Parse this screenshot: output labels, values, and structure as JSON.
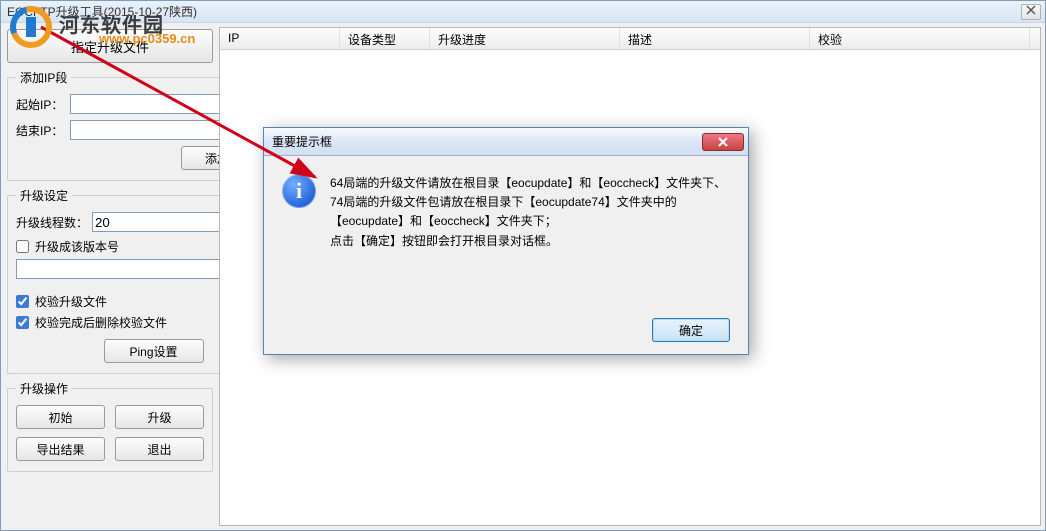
{
  "window_title": "EOCFTP升级工具(2015-10-27陕西)",
  "sidebar": {
    "specify_file_btn": "指定升级文件",
    "ip_section": {
      "legend": "添加IP段",
      "start_ip_label": "起始IP：",
      "start_ip_value": "",
      "end_ip_label": "结束IP：",
      "end_ip_value": "",
      "add_btn": "添加"
    },
    "upgrade_section": {
      "legend": "升级设定",
      "threads_label": "升级线程数：",
      "threads_value": "20",
      "upgrade_version_label": "升级成该版本号",
      "upgrade_version_value": "",
      "verify_label": "校验升级文件",
      "delete_after_label": "校验完成后删除校验文件",
      "ping_btn": "Ping设置"
    },
    "ops_section": {
      "legend": "升级操作",
      "init_btn": "初始",
      "upgrade_btn": "升级",
      "export_btn": "导出结果",
      "exit_btn": "退出"
    }
  },
  "table_headers": [
    "IP",
    "设备类型",
    "升级进度",
    "描述",
    "校验"
  ],
  "dialog": {
    "title": "重要提示框",
    "line1": "64局端的升级文件请放在根目录【eocupdate】和【eoccheck】文件夹下、",
    "line2": "74局端的升级文件包请放在根目录下【eocupdate74】文件夹中的【eocupdate】和【eoccheck】文件夹下；",
    "line3": "点击【确定】按钮即会打开根目录对话框。",
    "ok_btn": "确定"
  },
  "watermark": {
    "site_name": "河东软件园",
    "site_url": "www.pc0359.cn"
  },
  "colors": {
    "accent": "#1e5bd6",
    "arrow": "#d00018"
  }
}
